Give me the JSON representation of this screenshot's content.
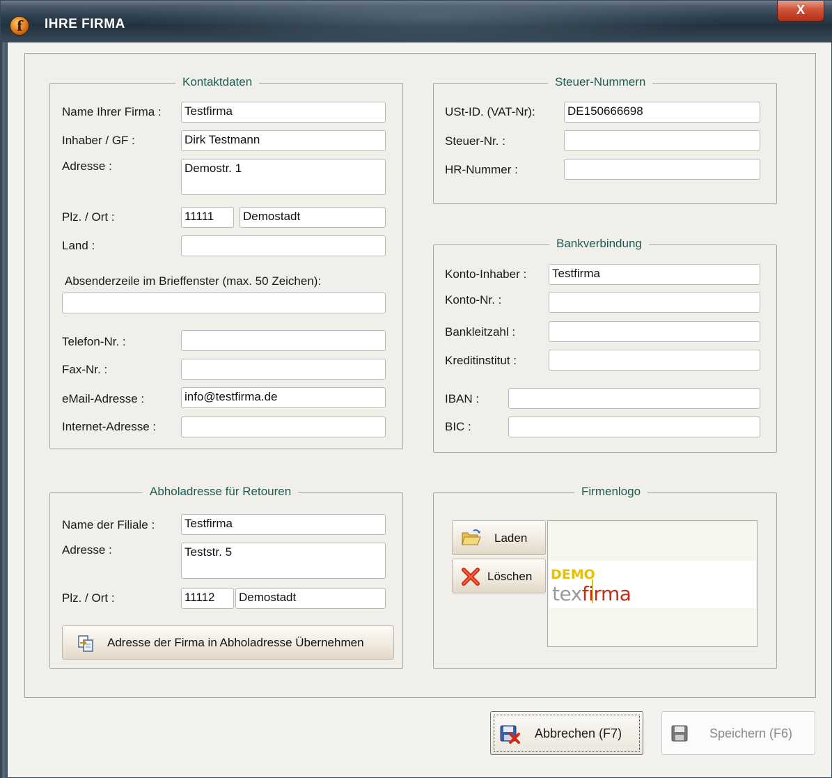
{
  "window": {
    "title": "IHRE FIRMA",
    "close_glyph": "X",
    "app_icon": "f"
  },
  "kontakt": {
    "legend": "Kontaktdaten",
    "name_label": "Name Ihrer Firma :",
    "name_value": "Testfirma",
    "inhaber_label": "Inhaber / GF :",
    "inhaber_value": "Dirk Testmann",
    "adresse_label": "Adresse :",
    "adresse_value": "Demostr. 1",
    "plz_label": "Plz. / Ort :",
    "plz_value": "11111",
    "ort_value": "Demostadt",
    "land_label": "Land :",
    "land_value": "",
    "absender_label": "Absenderzeile im Brieffenster (max. 50 Zeichen):",
    "absender_value": "",
    "telefon_label": "Telefon-Nr. :",
    "telefon_value": "",
    "fax_label": "Fax-Nr. :",
    "fax_value": "",
    "email_label": "eMail-Adresse :",
    "email_value": "info@testfirma.de",
    "internet_label": "Internet-Adresse :",
    "internet_value": ""
  },
  "steuer": {
    "legend": "Steuer-Nummern",
    "ust_label": "USt-ID. (VAT-Nr):",
    "ust_value": "DE150666698",
    "steuer_label": "Steuer-Nr. :",
    "steuer_value": "",
    "hr_label": "HR-Nummer :",
    "hr_value": ""
  },
  "bank": {
    "legend": "Bankverbindung",
    "inhaber_label": "Konto-Inhaber :",
    "inhaber_value": "Testfirma",
    "konto_label": "Konto-Nr. :",
    "konto_value": "",
    "blz_label": "Bankleitzahl :",
    "blz_value": "",
    "institut_label": "Kreditinstitut :",
    "institut_value": "",
    "iban_label": "IBAN :",
    "iban_value": "",
    "bic_label": "BIC :",
    "bic_value": ""
  },
  "abholung": {
    "legend": "Abholadresse für Retouren",
    "filiale_label": "Name der Filiale :",
    "filiale_value": "Testfirma",
    "adresse_label": "Adresse :",
    "adresse_value": "Teststr. 5",
    "plz_label": "Plz. / Ort :",
    "plz_value": "11112",
    "ort_value": "Demostadt",
    "copy_button": "Adresse der Firma in Abholadresse Übernehmen"
  },
  "logo": {
    "legend": "Firmenlogo",
    "load_button": "Laden",
    "delete_button": "Löschen",
    "image_demo": "DEMO",
    "image_tex": "tex",
    "image_firma": "firma"
  },
  "footer": {
    "cancel_button": "Abbrechen (F7)",
    "save_button": "Speichern (F6)"
  },
  "colors": {
    "legend_text": "#1f5a52",
    "title_bar": "#2c3d4e",
    "close_button": "#c8462c",
    "delete_icon": "#d42a10"
  }
}
